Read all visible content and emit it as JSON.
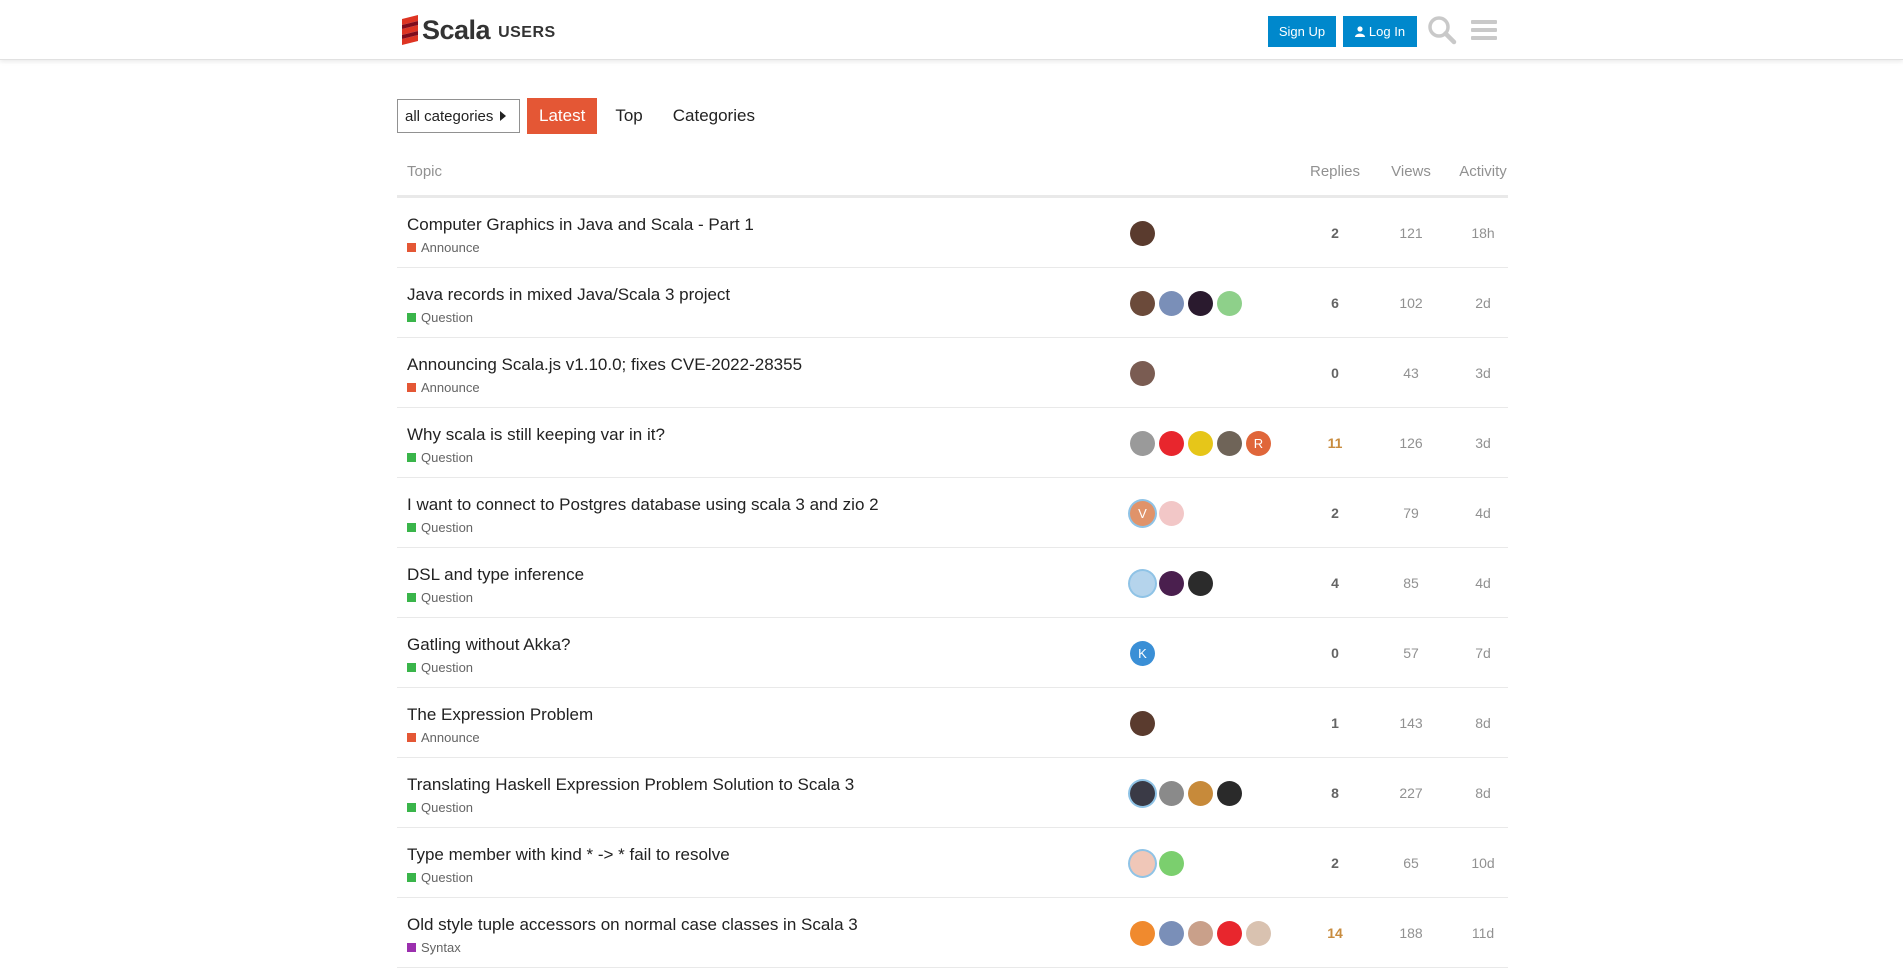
{
  "header": {
    "logo_word": "Scala",
    "logo_sub": "USERS",
    "signup_label": "Sign Up",
    "login_label": "Log In",
    "icons": [
      "scala-logo-icon",
      "user-icon",
      "search-icon",
      "hamburger-menu-icon"
    ]
  },
  "nav": {
    "category_dropdown": "all categories",
    "tabs": [
      "Latest",
      "Top",
      "Categories"
    ],
    "active_tab": "Latest"
  },
  "table": {
    "headers": {
      "topic": "Topic",
      "replies": "Replies",
      "views": "Views",
      "activity": "Activity"
    },
    "rows": [
      {
        "title": "Computer Graphics in Java and Scala - Part 1",
        "category": "Announce",
        "category_color": "#e45735",
        "replies": "2",
        "views": "121",
        "activity": "18h",
        "posters": [
          {
            "color": "#5a3b2e"
          }
        ]
      },
      {
        "title": "Java records in mixed Java/Scala 3 project",
        "category": "Question",
        "category_color": "#3ab54a",
        "replies": "6",
        "views": "102",
        "activity": "2d",
        "posters": [
          {
            "color": "#6b4a3a"
          },
          {
            "color": "#7a8fb8"
          },
          {
            "color": "#2a1a2e"
          },
          {
            "color": "#8ed08a"
          }
        ]
      },
      {
        "title": "Announcing Scala.js v1.10.0; fixes CVE-2022-28355",
        "category": "Announce",
        "category_color": "#e45735",
        "replies": "0",
        "views": "43",
        "activity": "3d",
        "posters": [
          {
            "color": "#7a5c52"
          }
        ]
      },
      {
        "title": "Why scala is still keeping var in it?",
        "category": "Question",
        "category_color": "#3ab54a",
        "replies": "11",
        "views": "126",
        "activity": "3d",
        "hot": true,
        "posters": [
          {
            "color": "#9a9a9a"
          },
          {
            "color": "#e8262d"
          },
          {
            "color": "#e6c619"
          },
          {
            "color": "#6f6458"
          },
          {
            "color": "#e0663a",
            "letter": "R"
          }
        ]
      },
      {
        "title": "I want to connect to Postgres database using scala 3 and zio 2",
        "category": "Question",
        "category_color": "#3ab54a",
        "replies": "2",
        "views": "79",
        "activity": "4d",
        "posters": [
          {
            "color": "#e0936a",
            "letter": "V",
            "ring": true
          },
          {
            "color": "#f2c7c7"
          }
        ]
      },
      {
        "title": "DSL and type inference",
        "category": "Question",
        "category_color": "#3ab54a",
        "replies": "4",
        "views": "85",
        "activity": "4d",
        "posters": [
          {
            "color": "#b5d4ec",
            "ring": true
          },
          {
            "color": "#4a1f4e"
          },
          {
            "color": "#2b2b2b"
          }
        ]
      },
      {
        "title": "Gatling without Akka?",
        "category": "Question",
        "category_color": "#3ab54a",
        "replies": "0",
        "views": "57",
        "activity": "7d",
        "posters": [
          {
            "color": "#3a8fd6",
            "letter": "K"
          }
        ]
      },
      {
        "title": "The Expression Problem",
        "category": "Announce",
        "category_color": "#e45735",
        "replies": "1",
        "views": "143",
        "activity": "8d",
        "posters": [
          {
            "color": "#5a3b2e"
          }
        ]
      },
      {
        "title": "Translating Haskell Expression Problem Solution to Scala 3",
        "category": "Question",
        "category_color": "#3ab54a",
        "replies": "8",
        "views": "227",
        "activity": "8d",
        "posters": [
          {
            "color": "#3a3a46",
            "ring": true
          },
          {
            "color": "#8a8a8a"
          },
          {
            "color": "#c78a3a"
          },
          {
            "color": "#2a2a2a"
          }
        ]
      },
      {
        "title": "Type member with kind * -> * fail to resolve",
        "category": "Question",
        "category_color": "#3ab54a",
        "replies": "2",
        "views": "65",
        "activity": "10d",
        "posters": [
          {
            "color": "#f0c7b8",
            "ring": true
          },
          {
            "color": "#7bcf6e"
          }
        ]
      },
      {
        "title": "Old style tuple accessors on normal case classes in Scala 3",
        "category": "Syntax",
        "category_color": "#9b2fae",
        "replies": "14",
        "views": "188",
        "activity": "11d",
        "hot": true,
        "posters": [
          {
            "color": "#f08a2e"
          },
          {
            "color": "#7a8fb8"
          },
          {
            "color": "#c9a08a"
          },
          {
            "color": "#e8262d"
          },
          {
            "color": "#d9c2b0"
          }
        ]
      }
    ]
  }
}
